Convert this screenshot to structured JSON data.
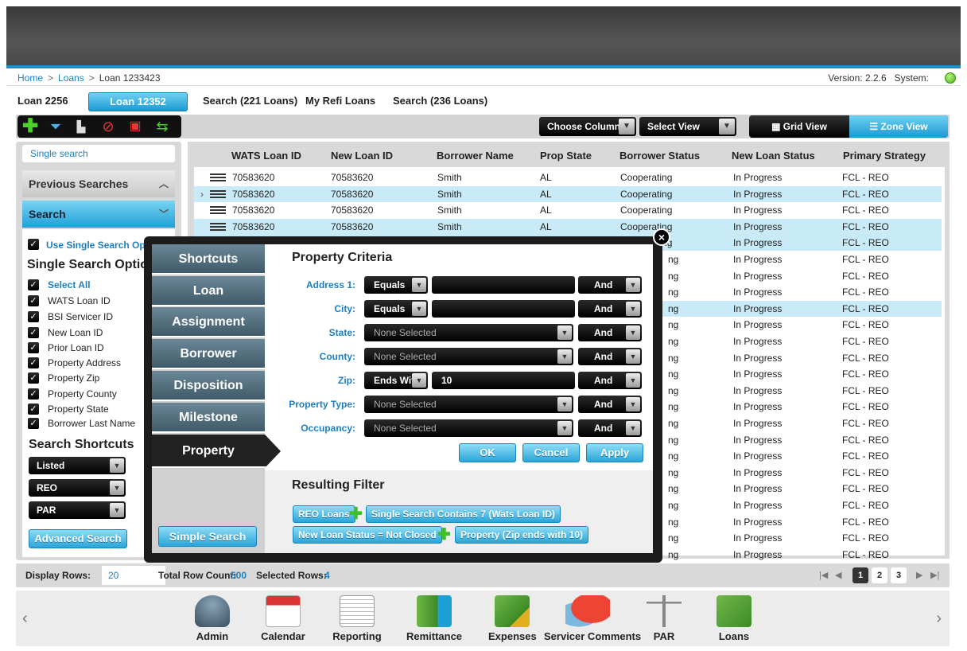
{
  "breadcrumb": {
    "home": "Home",
    "loans": "Loans",
    "current": "Loan 1233423"
  },
  "version": "Version: 2.2.6",
  "system_label": "System:",
  "tabs": [
    "Loan 2256",
    "Loan 12352",
    "Search (221 Loans)",
    "My Refi Loans",
    "Search (236 Loans)"
  ],
  "toolbar": {
    "choose_columns": "Choose Columns",
    "select_view": "Select View",
    "grid_view": "Grid View",
    "zone_view": "Zone View"
  },
  "left": {
    "single_search": "Single search",
    "previous_searches": "Previous Searches",
    "search": "Search",
    "use_single": "Use Single Search Opt",
    "options_title": "Single Search Options",
    "select_all": "Select All",
    "options": [
      "WATS Loan ID",
      "BSI Servicer ID",
      "New Loan ID",
      "Prior Loan ID",
      "Property Address",
      "Property Zip",
      "Property County",
      "Property State",
      "Borrower Last Name"
    ],
    "shortcuts_title": "Search Shortcuts",
    "shortcuts": [
      "Listed",
      "REO",
      "PAR"
    ],
    "advanced": "Advanced Search"
  },
  "grid": {
    "headers": [
      "WATS Loan ID",
      "New Loan ID",
      "Borrower Name",
      "Prop State",
      "Borrower Status",
      "New Loan Status",
      "Primary Strategy"
    ],
    "visible_rows": [
      {
        "wats": "70583620",
        "new": "70583620",
        "name": "Smith",
        "state": "AL",
        "bstatus": "Cooperating"
      },
      {
        "wats": "70583620",
        "new": "70583620",
        "name": "Smith",
        "state": "AL",
        "bstatus": "Cooperating"
      },
      {
        "wats": "70583620",
        "new": "70583620",
        "name": "Smith",
        "state": "AL",
        "bstatus": "Cooperating"
      },
      {
        "wats": "70583620",
        "new": "70583620",
        "name": "Smith",
        "state": "AL",
        "bstatus": "Cooperating"
      }
    ],
    "partial_status": [
      "Cooperating",
      "ng",
      "ng",
      "ng",
      "ng",
      "ng",
      "ng",
      "ng",
      "ng",
      "ng",
      "ng",
      "ng",
      "ng",
      "ng",
      "ng",
      "ng",
      "ng",
      "ng",
      "ng",
      "ng"
    ],
    "loan_status": "In Progress",
    "strategy": "FCL - REO"
  },
  "footer": {
    "display_rows": "Display Rows:",
    "display_val": "20",
    "total_label": "Total Row Count:",
    "total_val": "500",
    "selected_label": "Selected Rows:",
    "selected_val": "4",
    "pages": [
      "1",
      "2",
      "3"
    ]
  },
  "dock": [
    "Admin",
    "Calendar",
    "Reporting",
    "Remittance",
    "Expenses",
    "Servicer Comments",
    "PAR",
    "Loans"
  ],
  "modal": {
    "nav": [
      "Shortcuts",
      "Loan",
      "Assignment",
      "Borrower",
      "Disposition",
      "Milestone",
      "Property"
    ],
    "simple_search": "Simple Search",
    "title": "Property Criteria",
    "criteria": [
      {
        "label": "Address 1:",
        "op": "Equals",
        "value": "",
        "conj": "And",
        "type": "text"
      },
      {
        "label": "City:",
        "op": "Equals",
        "value": "",
        "conj": "And",
        "type": "text"
      },
      {
        "label": "State:",
        "op": "None Selected",
        "conj": "And",
        "type": "select"
      },
      {
        "label": "County:",
        "op": "None Selected",
        "conj": "And",
        "type": "select"
      },
      {
        "label": "Zip:",
        "op": "Ends With",
        "value": "10",
        "conj": "And",
        "type": "text"
      },
      {
        "label": "Property Type:",
        "op": "None Selected",
        "conj": "And",
        "type": "select"
      },
      {
        "label": "Occupancy:",
        "op": "None Selected",
        "conj": "And",
        "type": "select"
      }
    ],
    "ok": "OK",
    "cancel": "Cancel",
    "apply": "Apply",
    "result_title": "Resulting Filter",
    "chips": [
      "REO Loans",
      "Single Search Contains 7 (Wats Loan ID)",
      "New Loan Status = Not Closed",
      "Property (Zip ends with 10)"
    ]
  },
  "colors": {
    "accent": "#1e9fd6",
    "link": "#1e7fbf",
    "selected_row": "#c9ebf7"
  }
}
